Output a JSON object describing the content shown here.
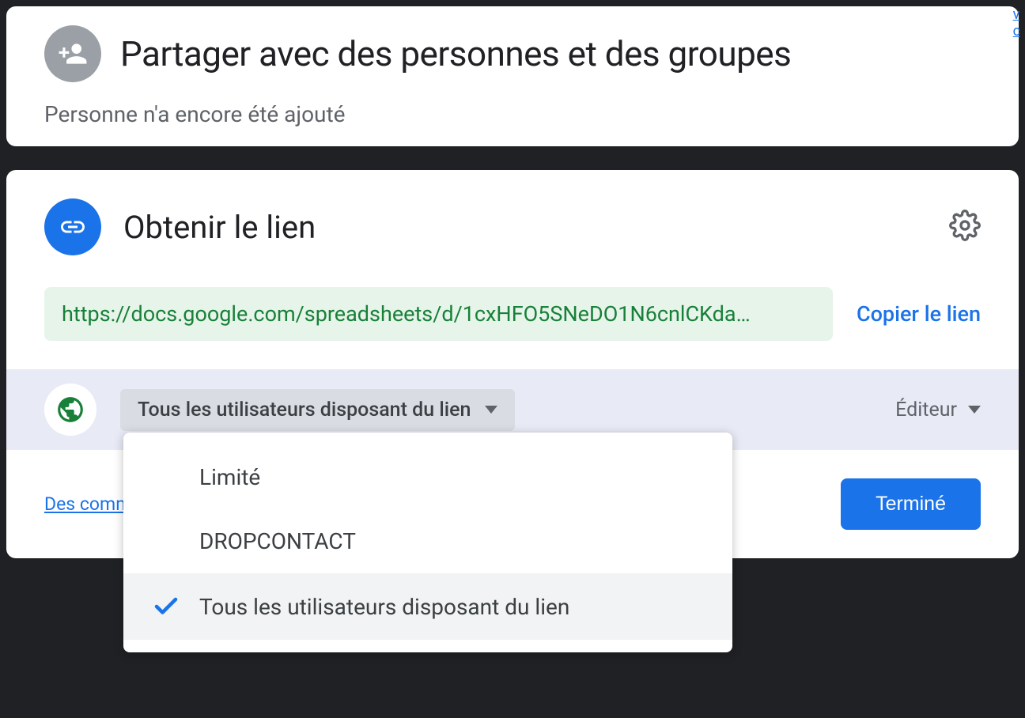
{
  "share_panel": {
    "title": "Partager avec des personnes et des groupes",
    "subtitle": "Personne n'a encore été ajouté"
  },
  "link_panel": {
    "title": "Obtenir le lien",
    "url": "https://docs.google.com/spreadsheets/d/1cxHFO5SNeDO1N6cnlCKda…",
    "copy_label": "Copier le lien",
    "access_selected": "Tous les utilisateurs disposant du lien",
    "role_selected": "Éditeur",
    "feedback_label": "Des comm",
    "done_label": "Terminé",
    "dropdown_options": [
      {
        "label": "Limité",
        "selected": false
      },
      {
        "label": "DROPCONTACT",
        "selected": false
      },
      {
        "label": "Tous les utilisateurs disposant du lien",
        "selected": true
      }
    ]
  },
  "sidebar": {
    "link1": "v",
    "link2": "c"
  }
}
